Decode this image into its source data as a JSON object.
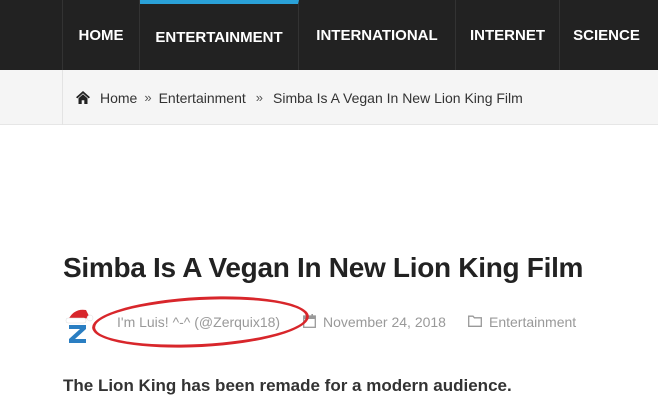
{
  "nav": {
    "items": [
      {
        "label": "HOME",
        "active": false
      },
      {
        "label": "ENTERTAINMENT",
        "active": true
      },
      {
        "label": "INTERNATIONAL",
        "active": false
      },
      {
        "label": "INTERNET",
        "active": false
      },
      {
        "label": "SCIENCE",
        "active": false
      }
    ],
    "accent_color": "#2aa1d8",
    "background": "#222222"
  },
  "breadcrumb": {
    "icon": "home-icon",
    "items": [
      "Home",
      "Entertainment",
      "Simba Is A Vegan In New Lion King Film"
    ],
    "separators": [
      "»",
      "»"
    ]
  },
  "article": {
    "title": "Simba Is A Vegan In New Lion King Film",
    "author": "I'm Luis! ^-^ (@Zerquix18)",
    "date": "November 24, 2018",
    "category": "Entertainment",
    "intro": "The Lion King has been remade for a modern audience.",
    "highlight_color": "#d8262b"
  }
}
